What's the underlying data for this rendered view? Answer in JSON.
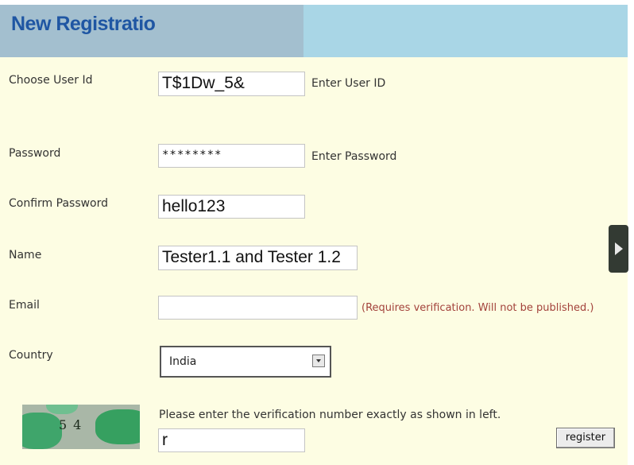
{
  "header": {
    "title": "New Registratio"
  },
  "form": {
    "user_id": {
      "label": "Choose User Id",
      "value": "T$1Dw_5&",
      "hint": "Enter User ID"
    },
    "password": {
      "label": "Password",
      "value": "********",
      "hint": "Enter Password"
    },
    "confirm_password": {
      "label": "Confirm Password",
      "value": "hello123"
    },
    "name": {
      "label": "Name",
      "value": "Tester1.1 and Tester 1.2"
    },
    "email": {
      "label": "Email",
      "value": "",
      "hint": "(Requires verification. Will not be published.)"
    },
    "country": {
      "label": "Country",
      "value": "India"
    },
    "verification": {
      "prompt": "Please enter the verification number exactly as shown in left.",
      "value": "r",
      "captcha_text": "54"
    },
    "register_label": "register"
  },
  "colors": {
    "page_bg": "#fdfde3",
    "header_bg": "#a9d6e6",
    "title_color": "#1f56a3",
    "hint_red": "#a3423b"
  },
  "icons": {
    "dropdown": "chevron-down-icon",
    "side_tab": "play-icon"
  }
}
